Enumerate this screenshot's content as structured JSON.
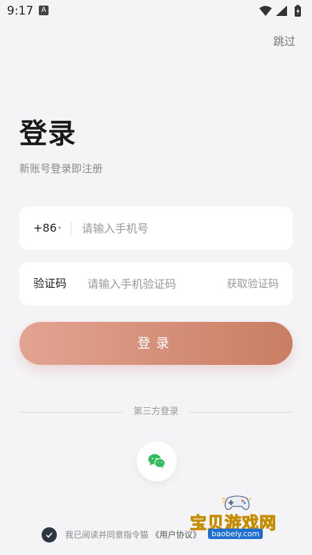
{
  "status_bar": {
    "time": "9:17",
    "notification": "A"
  },
  "header": {
    "skip_label": "跳过"
  },
  "login": {
    "title": "登录",
    "subtitle": "新账号登录即注册"
  },
  "phone_field": {
    "country_code": "+86",
    "arrow": "▾",
    "value": "",
    "placeholder": "请输入手机号"
  },
  "code_field": {
    "label": "验证码",
    "value": "",
    "placeholder": "请输入手机验证码",
    "get_code_label": "获取验证码"
  },
  "login_button": {
    "label": "登录"
  },
  "third_party": {
    "label": "第三方登录",
    "providers": [
      "wechat-icon"
    ]
  },
  "agreement": {
    "text": "我已阅读并同意指令猫",
    "link": "《用户协议》"
  },
  "watermark": {
    "title": "宝贝游戏网",
    "url": "baobely.com"
  },
  "colors": {
    "background": "#f4f4f6",
    "button_gradient_start": "#e3a392",
    "button_gradient_end": "#c97e62",
    "wechat_green": "#2fbb5a",
    "checkbox": "#2f3542"
  }
}
